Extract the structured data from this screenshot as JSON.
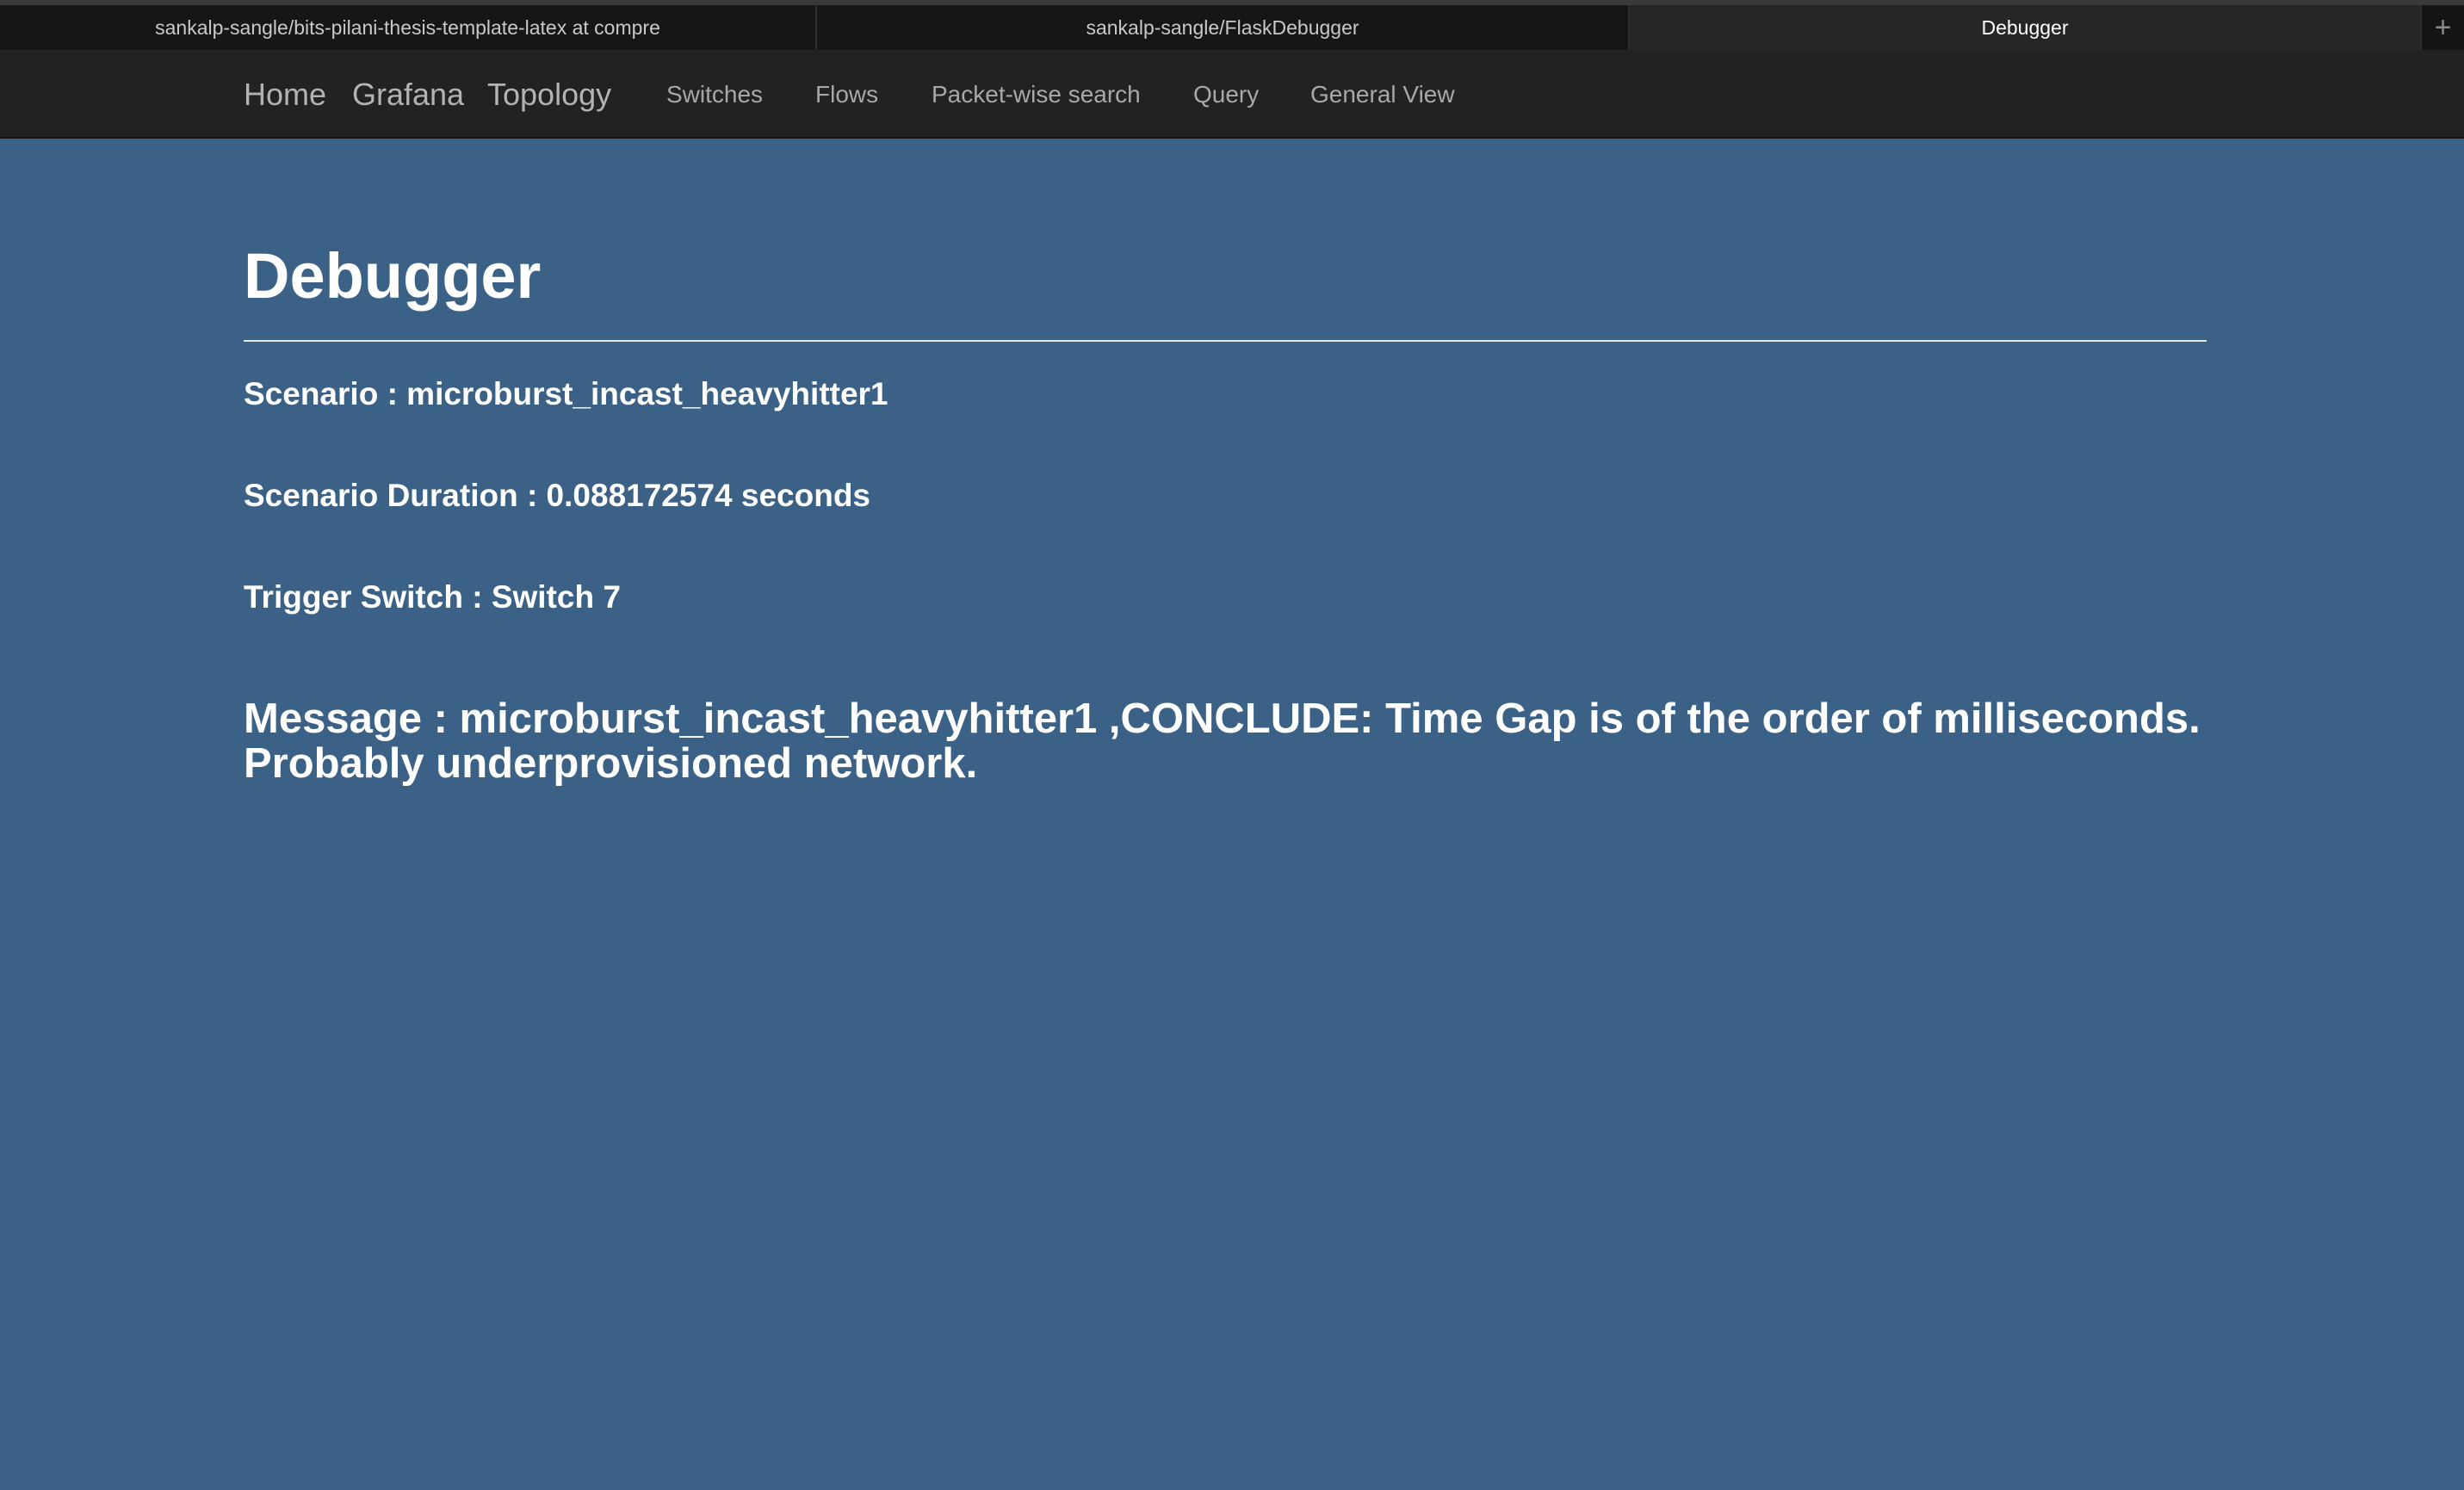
{
  "browser": {
    "tabs": [
      {
        "label": "sankalp-sangle/bits-pilani-thesis-template-latex at compre",
        "active": false
      },
      {
        "label": "sankalp-sangle/FlaskDebugger",
        "active": false
      },
      {
        "label": "Debugger",
        "active": true
      }
    ],
    "new_tab_icon": "plus-icon",
    "new_tab_glyph": "+"
  },
  "navbar": {
    "brand_items": [
      "Home",
      "Grafana",
      "Topology"
    ],
    "links": [
      "Switches",
      "Flows",
      "Packet-wise search",
      "Query",
      "General View"
    ]
  },
  "page": {
    "title": "Debugger",
    "scenario": "Scenario : microburst_incast_heavyhitter1",
    "duration": "Scenario Duration : 0.088172574 seconds",
    "trigger_switch": "Trigger Switch : Switch 7",
    "message": "Message : microburst_incast_heavyhitter1 ,CONCLUDE: Time Gap is of the order of milliseconds. Probably underprovisioned network."
  },
  "colors": {
    "background": "#3b6186",
    "navbar": "#222222",
    "tabstrip": "#0f0f0f",
    "text": "#ffffff",
    "nav_text": "#a8a8a8"
  }
}
